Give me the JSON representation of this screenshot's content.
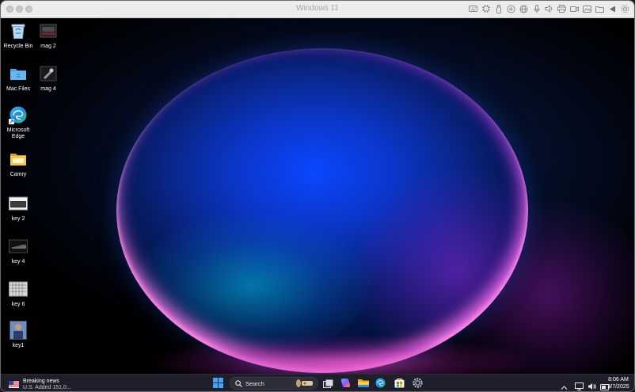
{
  "window": {
    "title": "Windows 11"
  },
  "titlebar_icons": [
    "keyboard-icon",
    "cpu-icon",
    "usb-icon",
    "network-icon",
    "globe-icon",
    "microphone-icon",
    "speaker-icon",
    "printer-icon",
    "camera-icon",
    "image-icon",
    "folder-icon",
    "play-back-icon",
    "gear-icon"
  ],
  "desktop": {
    "icons": [
      {
        "name": "recycle-bin",
        "label": "Recycle Bin",
        "icon": "recycle-bin-icon"
      },
      {
        "name": "mag2",
        "label": "mag 2",
        "icon": "image-file-icon"
      },
      {
        "name": "mac-files",
        "label": "Mac Files",
        "icon": "folder-icon"
      },
      {
        "name": "mag4",
        "label": "mag 4",
        "icon": "image-file-icon"
      },
      {
        "name": "microsoft-edge",
        "label": "Microsoft Edge",
        "icon": "edge-icon"
      },
      {
        "name": "camry",
        "label": "Camry",
        "icon": "folder-icon"
      },
      {
        "name": "key2",
        "label": "key 2",
        "icon": "image-file-icon"
      },
      {
        "name": "key4",
        "label": "key 4",
        "icon": "image-file-icon"
      },
      {
        "name": "key6",
        "label": "key 6",
        "icon": "image-file-icon"
      },
      {
        "name": "key1",
        "label": "key1",
        "icon": "image-file-icon"
      }
    ]
  },
  "taskbar": {
    "news": {
      "headline": "Breaking news",
      "sub": "U.S. Added 151,0..."
    },
    "search_label": "Search",
    "apps": [
      "start-icon",
      "task-view-icon",
      "copilot-icon",
      "file-explorer-icon",
      "edge-icon",
      "store-icon",
      "settings-icon"
    ],
    "tray": [
      "chevron-up-icon",
      "network-icon",
      "volume-icon",
      "battery-icon"
    ],
    "time": "8:06 AM",
    "date": "3/7/2025"
  },
  "colors": {
    "taskbar_bg": "#1e1f2a",
    "titlebar_bg": "#ececec",
    "orb_blue": "#0a47ff",
    "accent_pink": "#f050c8"
  }
}
